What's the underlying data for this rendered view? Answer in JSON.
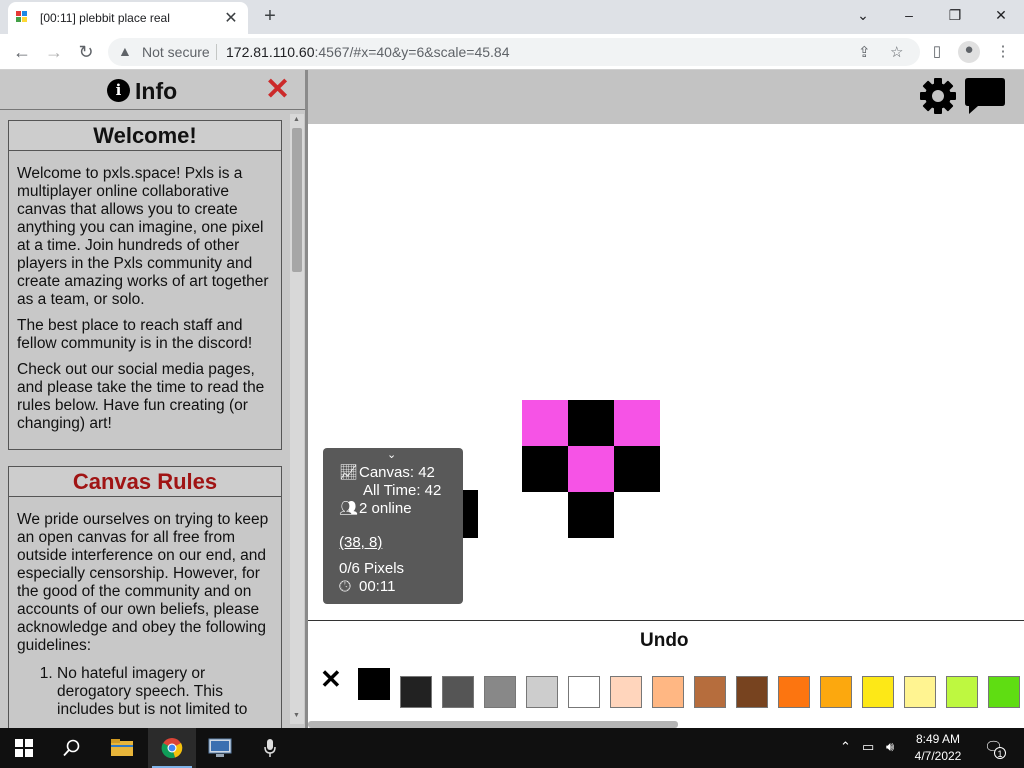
{
  "browser": {
    "tab_title": "[00:11] plebbit place real",
    "tab_close": "✕",
    "new_tab": "+",
    "controls": {
      "minimize": "⌄",
      "minimize2": "–",
      "restore": "❐",
      "close": "✕"
    },
    "security_label": "Not secure",
    "url_host": "172.81.110.60",
    "url_rest": ":4567/#x=40&y=6&scale=45.84"
  },
  "info_panel": {
    "title": "Info",
    "info_glyph": "i",
    "close_glyph": "✕",
    "welcome": {
      "heading": "Welcome!",
      "paragraphs": [
        "Welcome to pxls.space! Pxls is a multiplayer online collaborative canvas that allows you to create anything you can imagine, one pixel at a time. Join hundreds of other players in the Pxls community and create amazing works of art together as a team, or solo.",
        "The best place to reach staff and fellow community is in the discord!",
        "Check out our social media pages, and please take the time to read the rules below. Have fun creating (or changing) art!"
      ]
    },
    "rules": {
      "heading": "Canvas Rules",
      "intro": "We pride ourselves on trying to keep an open canvas for all free from outside interference on our end, and especially censorship. However, for the good of the community and on accounts of our own beliefs, please acknowledge and obey the following guidelines:",
      "item1": "No hateful imagery or derogatory speech. This includes but is not limited to"
    }
  },
  "stats": {
    "chevron": "⌄",
    "canvas": "Canvas: 42",
    "all_time": "All Time: 42",
    "online": "2 online",
    "coords": "(38, 8)",
    "pixels": "0/6 Pixels",
    "timer": "00:11"
  },
  "canvas_pixels": [
    {
      "col": 0,
      "row": 0,
      "color": "#f653e6"
    },
    {
      "col": 1,
      "row": 0,
      "color": "#000000"
    },
    {
      "col": 2,
      "row": 0,
      "color": "#f653e6"
    },
    {
      "col": 0,
      "row": 1,
      "color": "#000000"
    },
    {
      "col": 1,
      "row": 1,
      "color": "#f653e6"
    },
    {
      "col": 2,
      "row": 1,
      "color": "#000000"
    },
    {
      "col": 1,
      "row": 2,
      "color": "#000000"
    }
  ],
  "cursor_pixel_color": "#000000",
  "undo_label": "Undo",
  "palette_close": "✕",
  "palette": [
    "#000000",
    "#222222",
    "#555555",
    "#888888",
    "#cdcdcd",
    "#ffffff",
    "#ffd5bc",
    "#ffb783",
    "#b66d3d",
    "#77431f",
    "#fc7510",
    "#fca80e",
    "#fde817",
    "#fff491",
    "#bef840",
    "#5fdd12"
  ],
  "selected_swatch": 0,
  "taskbar": {
    "time": "8:49 AM",
    "date": "4/7/2022",
    "notification_count": "1"
  }
}
